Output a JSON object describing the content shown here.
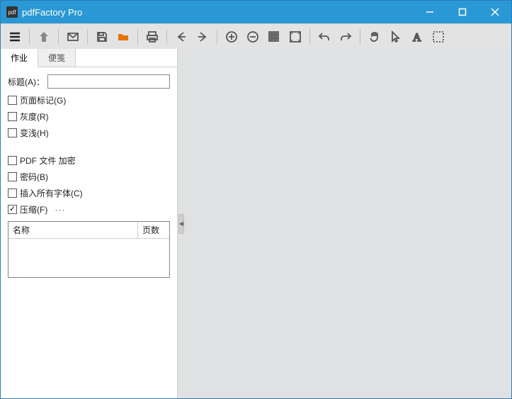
{
  "window": {
    "title": "pdfFactory Pro"
  },
  "tabs": {
    "job": "作业",
    "notes": "便笺"
  },
  "panel": {
    "title_label": "标题(A)：",
    "title_value": "",
    "chk_page_mark": "页面标记(G)",
    "chk_gray": "灰度(R)",
    "chk_fade": "变浅(H)",
    "chk_encrypt": "PDF 文件 加密",
    "chk_password": "密码(B)",
    "chk_embed_fonts": "插入所有字体(C)",
    "chk_compress": "压缩(F)",
    "ellipsis": "···"
  },
  "table": {
    "col_name": "名称",
    "col_pages": "页数"
  }
}
